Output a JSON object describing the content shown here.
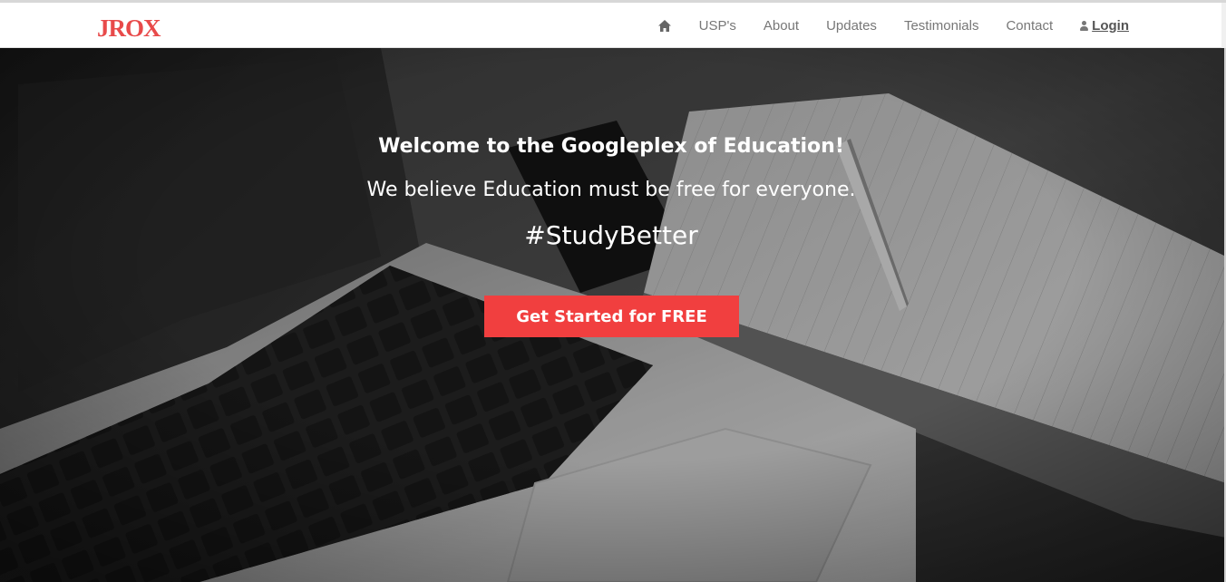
{
  "brand": {
    "logo_text": "JROX",
    "logo_color": "#e84a4a"
  },
  "nav": {
    "home_icon": "home-icon",
    "items": [
      {
        "label": "USP's"
      },
      {
        "label": "About"
      },
      {
        "label": "Updates"
      },
      {
        "label": "Testimonials"
      },
      {
        "label": "Contact"
      }
    ],
    "login": {
      "icon": "user-icon",
      "label": "Login"
    }
  },
  "hero": {
    "welcome": "Welcome to the Googleplex of Education!",
    "tagline": "We believe Education must be free for everyone.",
    "hashtag": "#StudyBetter",
    "cta_label": "Get Started for FREE",
    "cta_color": "#f13f3f"
  }
}
